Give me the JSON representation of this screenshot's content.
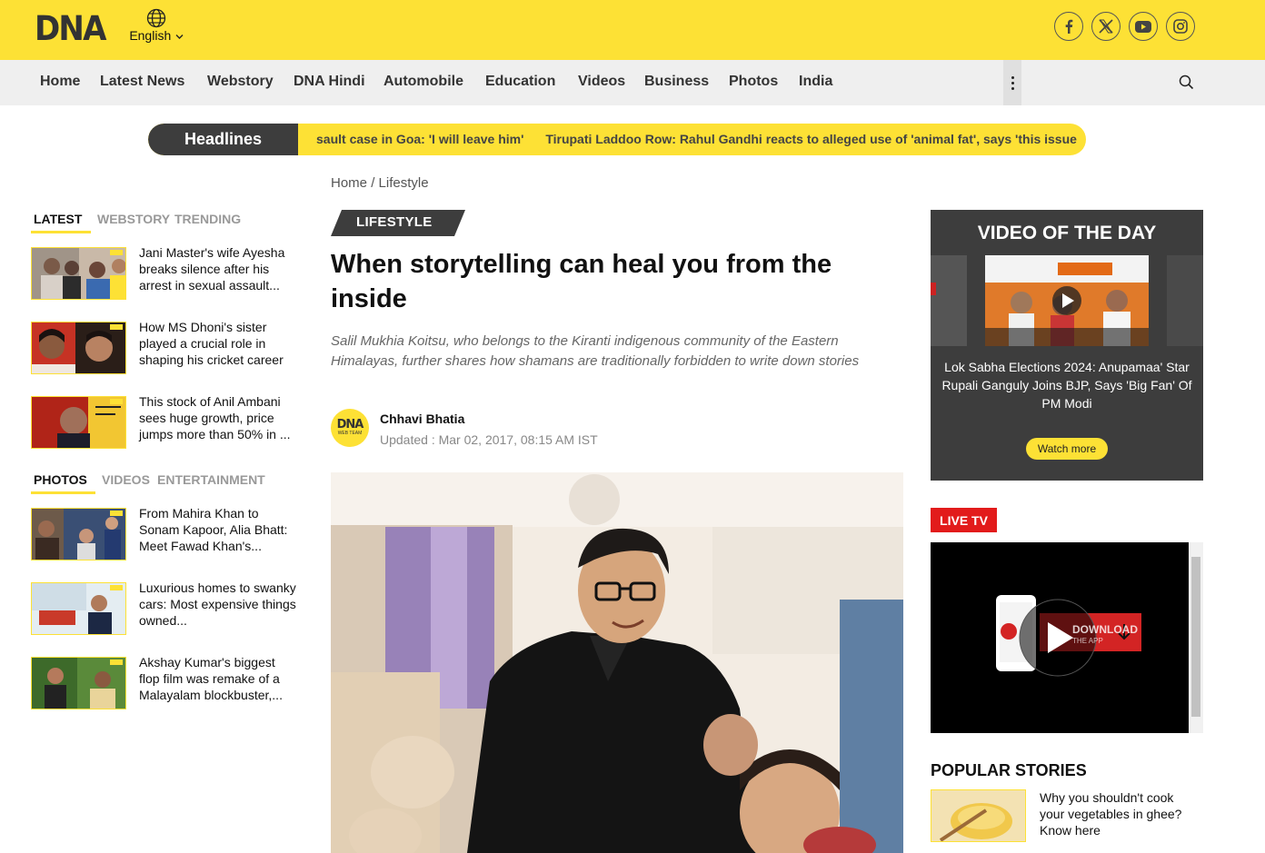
{
  "header": {
    "logo": "DNA",
    "language": "English",
    "social": [
      "facebook-icon",
      "x-icon",
      "youtube-icon",
      "instagram-icon"
    ]
  },
  "nav": {
    "items": [
      "Home",
      "Latest News",
      "Webstory",
      "DNA Hindi",
      "Automobile",
      "Education",
      "Videos",
      "Business",
      "Photos",
      "India"
    ]
  },
  "ticker": {
    "label": "Headlines",
    "items": [
      "sault case in Goa: 'I will leave him'",
      "Tirupati Laddoo Row: Rahul Gandhi reacts to alleged use of 'animal fat', says 'this issue"
    ]
  },
  "left": {
    "tabs1": [
      "LATEST",
      "WEBSTORY",
      "TRENDING"
    ],
    "list1": [
      "Jani Master's wife Ayesha breaks silence after his arrest in sexual assault...",
      "How MS Dhoni's sister played a crucial role in shaping his cricket career",
      "This stock of Anil Ambani sees huge growth, price jumps more than 50% in ..."
    ],
    "tabs2": [
      "PHOTOS",
      "VIDEOS",
      "ENTERTAINMENT"
    ],
    "list2": [
      "From Mahira Khan to Sonam Kapoor, Alia Bhatt: Meet Fawad Khan's...",
      "Luxurious homes to swanky cars: Most expensive things owned...",
      "Akshay Kumar's biggest flop film was remake of a Malayalam blockbuster,..."
    ]
  },
  "article": {
    "breadcrumb_home": "Home",
    "breadcrumb_sep": "/",
    "breadcrumb_section": "Lifestyle",
    "category": "LIFESTYLE",
    "title": "When storytelling can heal you from the inside",
    "summary": "Salil Mukhia Koitsu, who belongs to the Kiranti indigenous community of the Eastern Himalayas, further shares how shamans are traditionally forbidden to write down stories",
    "author_logo": "DNA",
    "author_logo_sub": "WEB TEAM",
    "author": "Chhavi Bhatia",
    "updated": "Updated : Mar 02, 2017, 08:15 AM IST"
  },
  "right": {
    "votd_title": "VIDEO OF THE DAY",
    "votd_caption": "Lok Sabha Elections 2024: Anupamaa' Star Rupali Ganguly Joins BJP, Says 'Big Fan' Of PM Modi",
    "watch_more": "Watch more",
    "live_label": "LIVE TV",
    "live_promo": "DOWNLOAD",
    "live_promo_sub": "THE APP",
    "popular_title": "POPULAR STORIES",
    "popular_item": "Why you shouldn't cook your vegetables in ghee? Know here"
  },
  "colors": {
    "brand_yellow": "#fde135",
    "dark": "#3d3d3d",
    "live_red": "#e21b1b"
  }
}
